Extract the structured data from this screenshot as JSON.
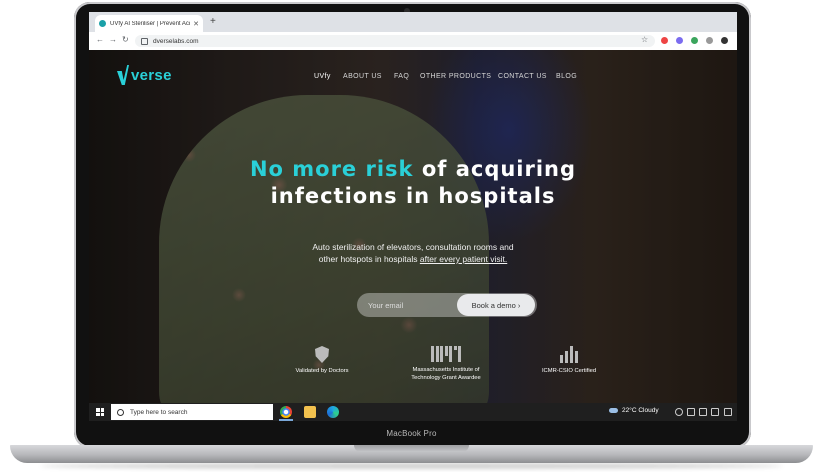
{
  "device": {
    "label": "MacBook Pro"
  },
  "browser": {
    "tab_title": "UVfy AI Steriliser | Prevent Acqui",
    "url": "dverselabs.com"
  },
  "site": {
    "logo_text": "verse",
    "nav": [
      "UVfy",
      "ABOUT US",
      "FAQ",
      "OTHER PRODUCTS",
      "CONTACT US",
      "BLOG"
    ],
    "hero_accent": "No more risk",
    "hero_line1_rest": " of acquiring",
    "hero_line2": "infections in hospitals",
    "sub_line1": "Auto sterilization of elevators, consultation rooms and",
    "sub_line2_plain": "other hotspots in hospitals ",
    "sub_line2_underlined": "after every patient visit.",
    "email_placeholder": "Your email",
    "demo_button": "Book a demo ›",
    "badges": [
      {
        "line1": "Validated by Doctors",
        "line2": ""
      },
      {
        "line1": "Massachusetts Institute of",
        "line2": "Technology Grant Awardee"
      },
      {
        "line1": "ICMR-CSIO Certified",
        "line2": ""
      }
    ]
  },
  "taskbar": {
    "search_placeholder": "Type here to search",
    "weather": "22°C  Cloudy"
  }
}
